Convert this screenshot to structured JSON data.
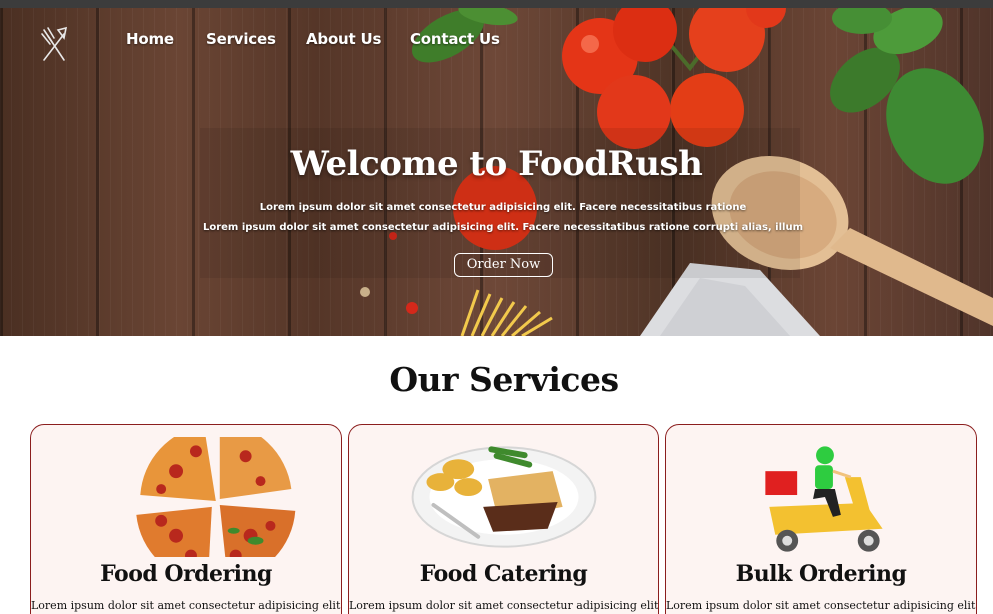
{
  "nav": {
    "logo_icon": "fork-knife-icon",
    "links": [
      "Home",
      "Services",
      "About Us",
      "Contact Us"
    ]
  },
  "hero": {
    "title": "Welcome to FoodRush",
    "line1": "Lorem ipsum dolor sit amet consectetur adipisicing elit. Facere necessitatibus ratione",
    "line2": "Lorem ipsum dolor sit amet consectetur adipisicing elit. Facere necessitatibus ratione corrupti alias, illum",
    "button_label": "Order Now"
  },
  "services": {
    "title": "Our Services",
    "cards": [
      {
        "title": "Food Ordering",
        "text": "Lorem ipsum dolor sit amet consectetur adipisicing elit.",
        "image_icon": "pizza-image"
      },
      {
        "title": "Food Catering",
        "text": "Lorem ipsum dolor sit amet consectetur adipisicing elit.",
        "image_icon": "food-plate-image"
      },
      {
        "title": "Bulk Ordering",
        "text": "Lorem ipsum dolor sit amet consectetur adipisicing elit.",
        "image_icon": "delivery-scooter-image"
      }
    ]
  },
  "colors": {
    "card_border": "#8b1e1e",
    "card_background": "#fdf4f2",
    "hero_text": "#ffffff"
  }
}
